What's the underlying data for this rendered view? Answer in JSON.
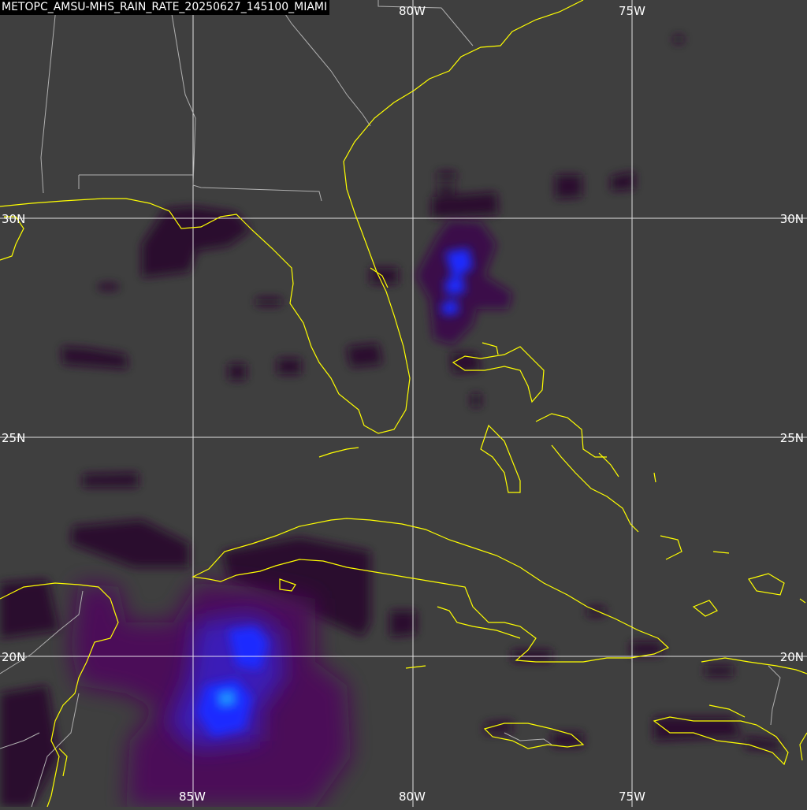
{
  "title": "METOPC_AMSU-MHS_RAIN_RATE_20250627_145100_MIAMI",
  "grid": {
    "lon_top": [
      "80W",
      "75W"
    ],
    "lon_bottom": [
      "85W",
      "80W",
      "75W"
    ],
    "lat_left": [
      "30N",
      "25N",
      "20N"
    ],
    "lat_right": [
      "30N",
      "25N",
      "20N"
    ]
  },
  "colors": {
    "background": "#3f3f3f",
    "coastline": "#ffff00",
    "borders": "#b0b0b0",
    "gridlines": "#ffffff",
    "rain_light": "#2a0a2e",
    "rain_moderate": "#4b1058",
    "rain_heavy": "#1c2cff",
    "rain_peak": "#1e90ff"
  }
}
